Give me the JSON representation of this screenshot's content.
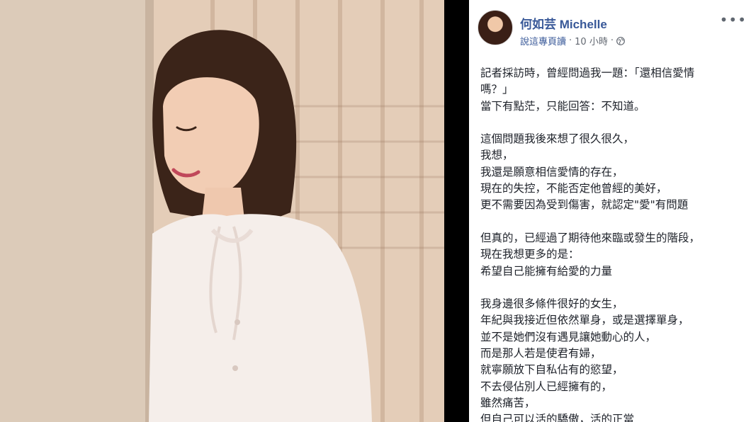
{
  "post": {
    "author": "何如芸 Michelle",
    "meta": {
      "shared_by": "說這專頁讀",
      "separator": " · ",
      "time": "10 小時",
      "privacy_icon": "globe-icon"
    },
    "more_icon": "more-options-icon",
    "paragraphs": [
      [
        "記者採訪時，曾經問過我一題：「還相信愛情",
        "嗎？」",
        "當下有點茫，只能回答：不知道。"
      ],
      [
        "這個問題我後來想了很久很久，",
        "我想，",
        "我還是願意相信愛情的存在，",
        "現在的失控，不能否定他曾經的美好，",
        "更不需要因為受到傷害，就認定\"愛\"有問題"
      ],
      [
        "但真的，已經過了期待他來臨或發生的階段，",
        "現在我想更多的是：",
        "希望自己能擁有給愛的力量"
      ],
      [
        "我身邊很多條件很好的女生，",
        "年紀與我接近但依然單身，或是選擇單身，",
        "並不是她們沒有遇見讓她動心的人，",
        "而是那人若是使君有婦，",
        "就寧願放下自私佔有的慾望，",
        "不去侵佔別人已經擁有的，",
        "雖然痛苦，",
        "但自己可以活的驕傲，活的正當"
      ]
    ]
  },
  "photo": {
    "description_icon": "photo-of-woman"
  },
  "colors": {
    "link": "#385898",
    "text": "#1d2129",
    "meta": "#616770"
  }
}
